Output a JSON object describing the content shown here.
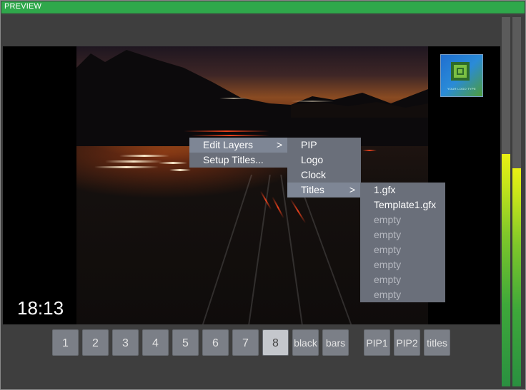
{
  "window": {
    "title": "PREVIEW"
  },
  "overlay": {
    "clock": "18:13",
    "logo_text": "YOUR LOGO TYPE"
  },
  "context_menu": {
    "items": [
      {
        "label": "Edit Layers",
        "arrow": ">"
      },
      {
        "label": "Setup Titles..."
      }
    ]
  },
  "layers_menu": {
    "items": [
      {
        "label": "PIP"
      },
      {
        "label": "Logo"
      },
      {
        "label": "Clock"
      },
      {
        "label": "Titles",
        "arrow": ">"
      }
    ]
  },
  "titles_menu": {
    "items": [
      {
        "label": "1.gfx"
      },
      {
        "label": "Template1.gfx"
      },
      {
        "label": "empty"
      },
      {
        "label": "empty"
      },
      {
        "label": "empty"
      },
      {
        "label": "empty"
      },
      {
        "label": "empty"
      },
      {
        "label": "empty"
      }
    ]
  },
  "buttons": {
    "b1": "1",
    "b2": "2",
    "b3": "3",
    "b4": "4",
    "b5": "5",
    "b6": "6",
    "b7": "7",
    "b8": "8",
    "black": "black",
    "bars": "bars",
    "pip1": "PIP1",
    "pip2": "PIP2",
    "titles": "titles",
    "active": "8"
  },
  "audio_meters": {
    "left_level": 0.63,
    "right_level": 0.59
  },
  "colors": {
    "titlebar": "#2fa84b",
    "menu_bg": "#6a6f7a",
    "menu_selected": "#7e8695"
  }
}
